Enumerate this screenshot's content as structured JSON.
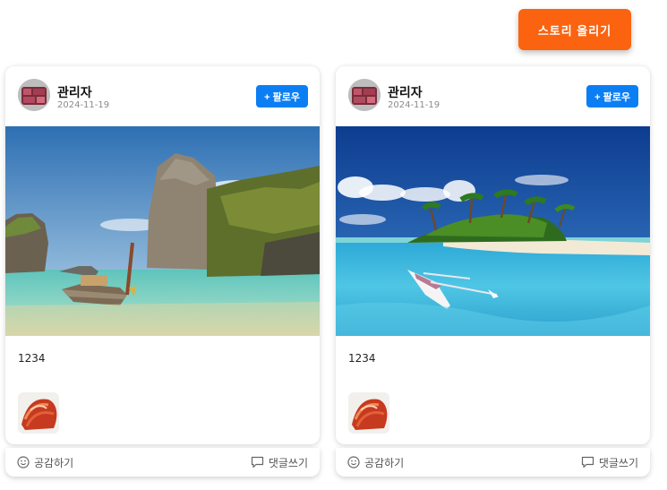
{
  "header": {
    "story_button_label": "스토리 올리기",
    "story_button_color": "#fb6310"
  },
  "posts": [
    {
      "author": "관리자",
      "date": "2024-11-19",
      "follow_label": "+ 팔로우",
      "text": "1234",
      "like_label": "공감하기",
      "comment_label": "댓글쓰기",
      "like_icon": "smile-icon",
      "comment_icon": "speech-bubble-icon"
    },
    {
      "author": "관리자",
      "date": "2024-11-19",
      "follow_label": "+ 팔로우",
      "text": "1234",
      "like_label": "공감하기",
      "comment_label": "댓글쓰기",
      "like_icon": "smile-icon",
      "comment_icon": "speech-bubble-icon"
    }
  ],
  "colors": {
    "follow_button": "#0b7ef3",
    "accent": "#fb6310"
  }
}
